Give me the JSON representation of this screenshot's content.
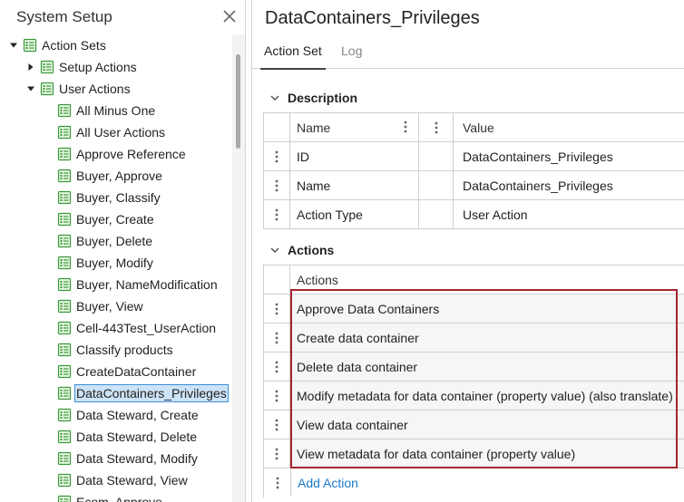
{
  "left_panel": {
    "title": "System Setup",
    "tree": [
      {
        "label": "Action Sets",
        "expanded": true,
        "icon": "action-set-icon"
      },
      {
        "label": "Setup Actions",
        "expanded": false,
        "icon": "action-set-icon"
      },
      {
        "label": "User Actions",
        "expanded": true,
        "icon": "action-set-icon"
      },
      {
        "label": "All Minus One",
        "icon": "action-set-icon"
      },
      {
        "label": "All User Actions",
        "icon": "action-set-icon"
      },
      {
        "label": "Approve Reference",
        "icon": "action-set-icon"
      },
      {
        "label": "Buyer, Approve",
        "icon": "action-set-icon"
      },
      {
        "label": "Buyer, Classify",
        "icon": "action-set-icon"
      },
      {
        "label": "Buyer, Create",
        "icon": "action-set-icon"
      },
      {
        "label": "Buyer, Delete",
        "icon": "action-set-icon"
      },
      {
        "label": "Buyer, Modify",
        "icon": "action-set-icon"
      },
      {
        "label": "Buyer, NameModification",
        "icon": "action-set-icon"
      },
      {
        "label": "Buyer, View",
        "icon": "action-set-icon"
      },
      {
        "label": "Cell-443Test_UserAction",
        "icon": "action-set-icon"
      },
      {
        "label": "Classify products",
        "icon": "action-set-icon"
      },
      {
        "label": "CreateDataContainer",
        "icon": "action-set-icon"
      },
      {
        "label": "DataContainers_Privileges",
        "icon": "action-set-icon",
        "selected": true
      },
      {
        "label": "Data Steward, Create",
        "icon": "action-set-icon"
      },
      {
        "label": "Data Steward, Delete",
        "icon": "action-set-icon"
      },
      {
        "label": "Data Steward, Modify",
        "icon": "action-set-icon"
      },
      {
        "label": "Data Steward, View",
        "icon": "action-set-icon"
      },
      {
        "label": "Ecom, Approve",
        "icon": "action-set-icon"
      }
    ]
  },
  "main": {
    "title": "DataContainers_Privileges",
    "tabs": [
      {
        "label": "Action Set",
        "active": true
      },
      {
        "label": "Log",
        "active": false
      }
    ],
    "description": {
      "title": "Description",
      "columns": {
        "name": "Name",
        "value": "Value"
      },
      "rows": [
        {
          "name": "ID",
          "value": "DataContainers_Privileges"
        },
        {
          "name": "Name",
          "value": "DataContainers_Privileges"
        },
        {
          "name": "Action Type",
          "value": "User Action"
        }
      ]
    },
    "actions": {
      "title": "Actions",
      "column": "Actions",
      "rows": [
        "Approve Data Containers",
        "Create data container",
        "Delete data container",
        "Modify metadata for data container (property value) (also translate)",
        "View data container",
        "View metadata for data container (property value)"
      ],
      "add_label": "Add Action"
    }
  },
  "colors": {
    "selection_fill": "#cde3f7",
    "selection_border": "#3e8fd6",
    "highlight_border": "#a3252f",
    "link": "#1b78c8",
    "icon_green": "#3a9a3a"
  }
}
